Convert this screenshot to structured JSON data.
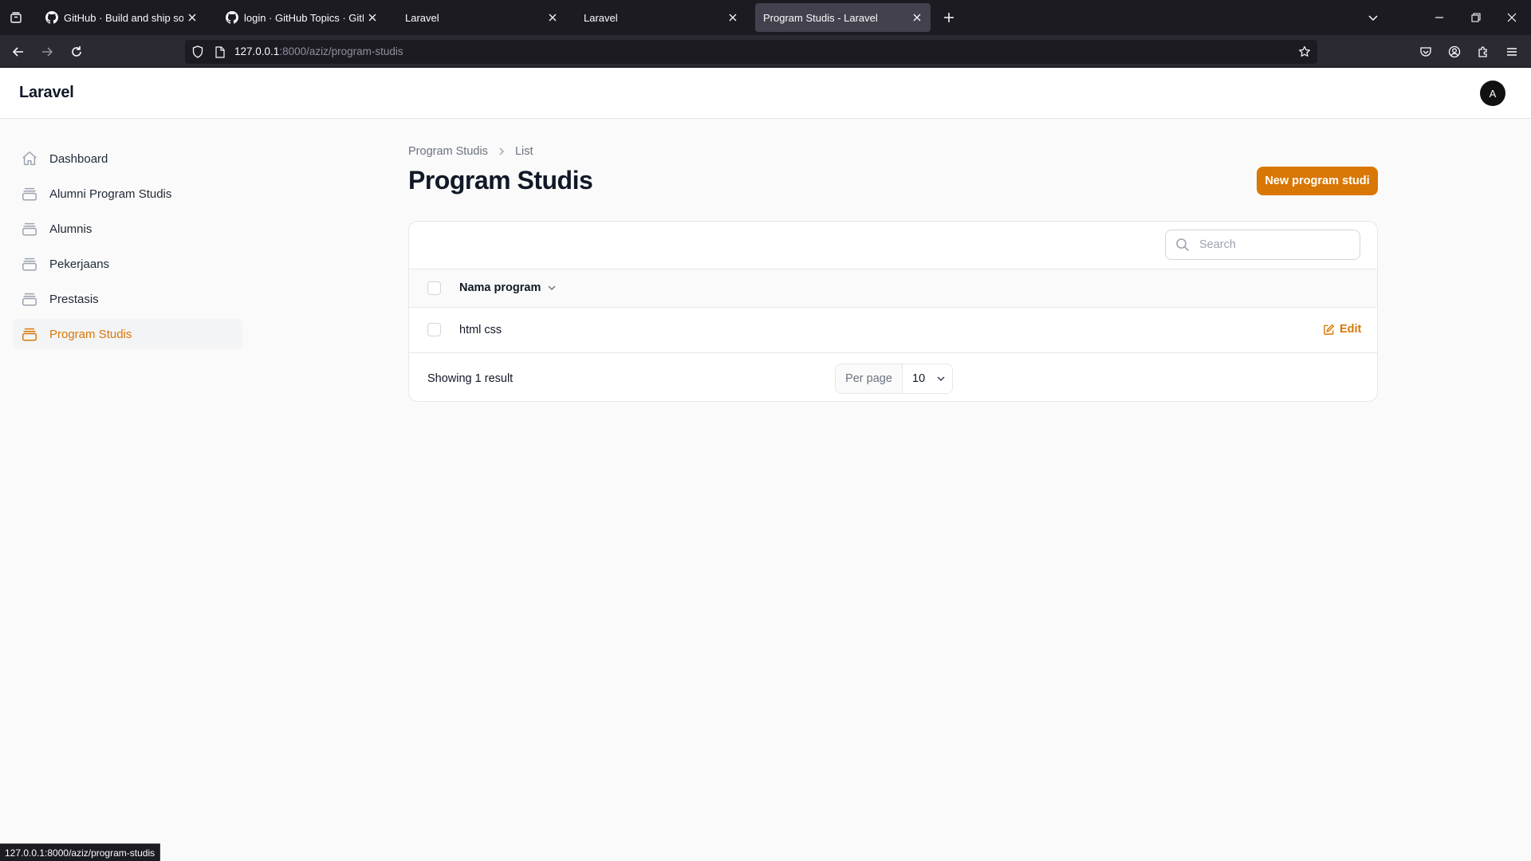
{
  "browser": {
    "tabs": [
      {
        "title": "GitHub · Build and ship softwar",
        "favicon": "github-icon",
        "active": false
      },
      {
        "title": "login · GitHub Topics · GitHub",
        "favicon": "github-icon",
        "active": false
      },
      {
        "title": "Laravel",
        "favicon": "",
        "active": false
      },
      {
        "title": "Laravel",
        "favicon": "",
        "active": false
      },
      {
        "title": "Program Studis - Laravel",
        "favicon": "",
        "active": true
      }
    ],
    "url_host": "127.0.0.1",
    "url_rest": ":8000/aziz/program-studis",
    "status_url": "127.0.0.1:8000/aziz/program-studis"
  },
  "app": {
    "brand": "Laravel",
    "avatar_initial": "A",
    "accent_color": "#d97706"
  },
  "sidebar": {
    "items": [
      {
        "label": "Dashboard",
        "icon": "home-icon",
        "active": false
      },
      {
        "label": "Alumni Program Studis",
        "icon": "collection-icon",
        "active": false
      },
      {
        "label": "Alumnis",
        "icon": "collection-icon",
        "active": false
      },
      {
        "label": "Pekerjaans",
        "icon": "collection-icon",
        "active": false
      },
      {
        "label": "Prestasis",
        "icon": "collection-icon",
        "active": false
      },
      {
        "label": "Program Studis",
        "icon": "collection-icon",
        "active": true
      }
    ]
  },
  "main": {
    "breadcrumb": [
      "Program Studis",
      "List"
    ],
    "title": "Program Studis",
    "new_button": "New program studi",
    "search_placeholder": "Search",
    "table": {
      "columns": [
        "Nama program"
      ],
      "rows": [
        {
          "nama_program": "html css",
          "action": "Edit"
        }
      ]
    },
    "showing": "Showing 1 result",
    "per_page_label": "Per page",
    "per_page_value": "10"
  }
}
